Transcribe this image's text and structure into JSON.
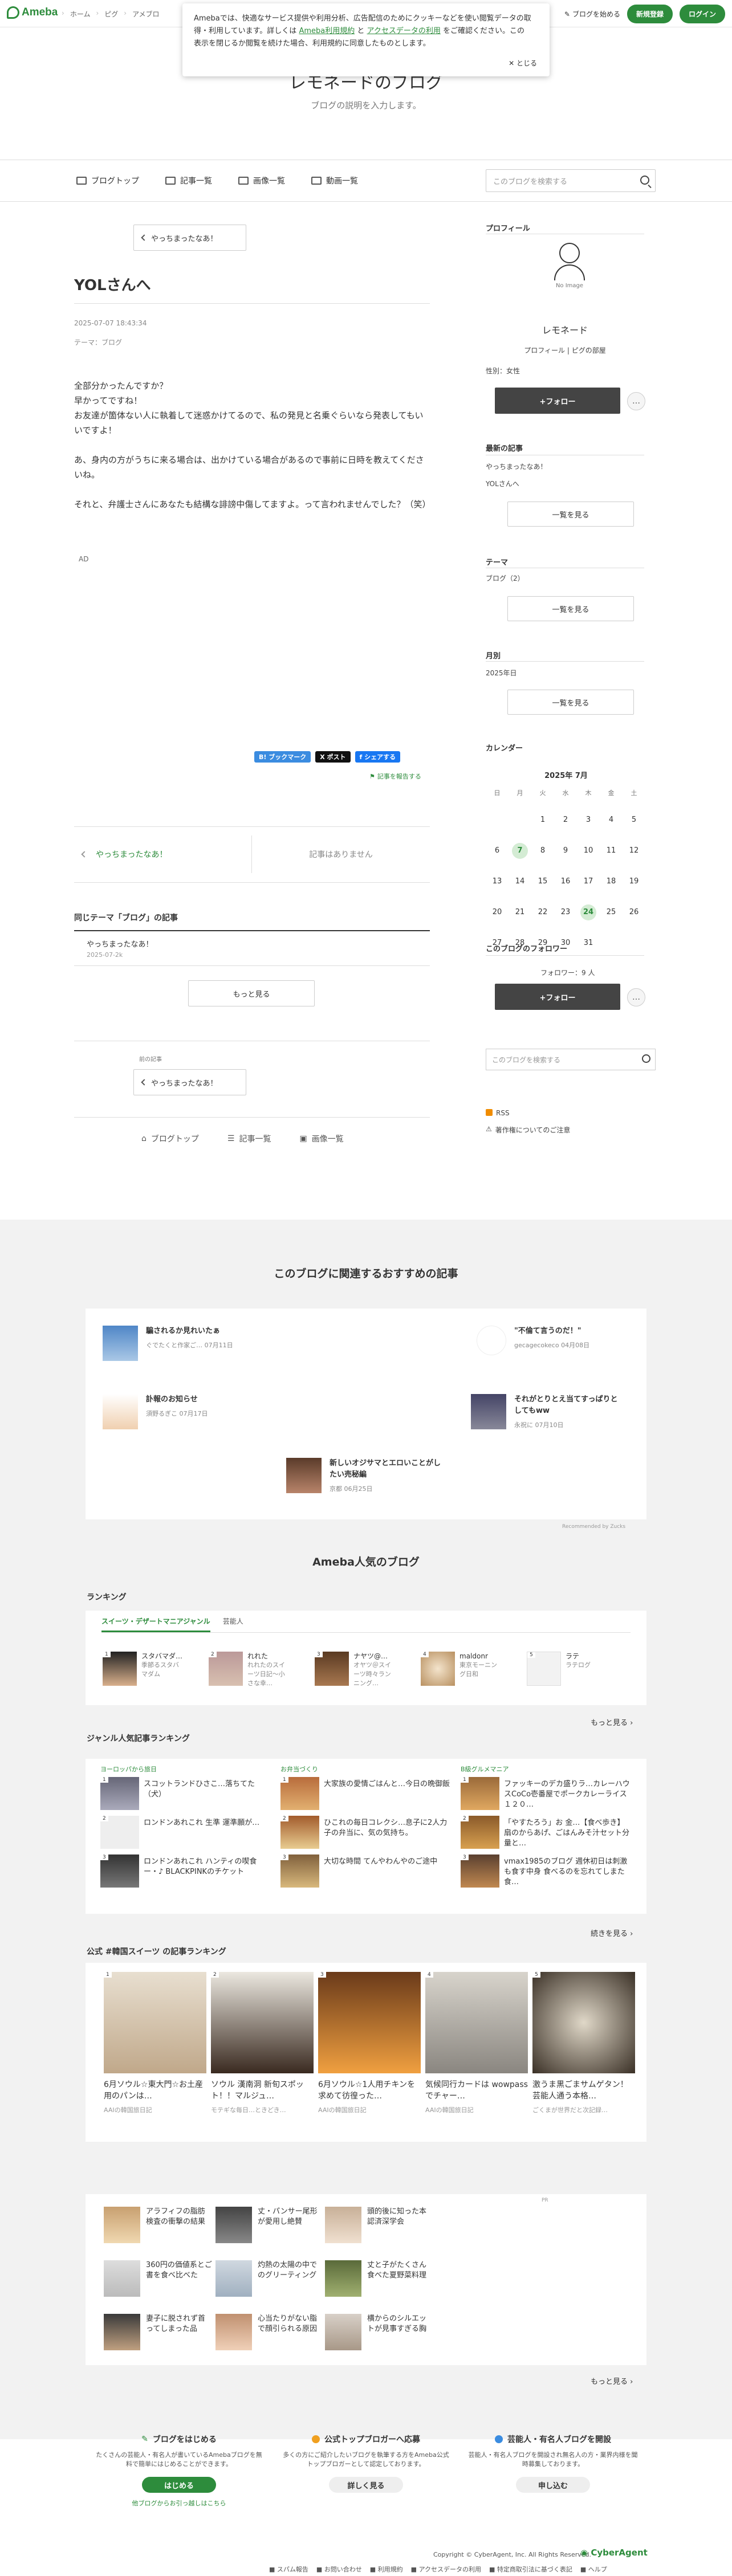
{
  "topbar": {
    "logo": "Ameba",
    "breadcrumb": [
      "ホーム",
      "ピグ",
      "アメブロ"
    ],
    "new_blog": "ブログを始める",
    "register": "新規登録",
    "login": "ログイン"
  },
  "cookie": {
    "line1": "Amebaでは、快適なサービス提供や利用分析、広告配信のためにクッキーなどを使い閲覧データの取",
    "line2a": "得・利用しています。詳しくは",
    "link1": "Ameba利用規約",
    "and": "と",
    "link2": "アクセスデータの利用",
    "line2b": "をご確認ください。この",
    "line3": "表示を閉じるか閲覧を続けた場合、利用規約に同意したものとします。",
    "close": "とじる"
  },
  "header": {
    "title": "レモネードのブログ",
    "description": "ブログの説明を入力します。"
  },
  "nav": {
    "items": [
      "ブログトップ",
      "記事一覧",
      "画像一覧",
      "動画一覧"
    ],
    "search_placeholder": "このブログを検索する"
  },
  "article": {
    "prev_button": "やっちまったなあ！",
    "title": "YOLさんへ",
    "date": "2025-07-07 18:43:34",
    "theme": "テーマ：ブログ",
    "paragraphs": [
      "全部分かったんですか？\n早かってですね！\nお友達が箇体ない人に執着して迷惑かけてるので、私の発見と名乗ぐらいなら発表してもいいですよ！",
      "あ、身内の方がうちに来る場合は、出かけている場合があるので事前に日時を教えてくださいね。",
      "それと、弁護士さんにあなたも結構な誹謗中傷してますよ。って言われませんでした？（笑）"
    ],
    "ad": "AD",
    "share": {
      "bookmark": "B! ブックマーク",
      "x": "X ポスト",
      "facebook": "f シェアする"
    },
    "report": "記事を報告する",
    "pager_prev": "やっちまったなあ！",
    "pager_next": "記事はありません"
  },
  "same_theme": {
    "heading": "同じテーマ「ブログ」の記事",
    "items": [
      {
        "title": "やっちまったなあ！",
        "date": "2025-07-2k"
      }
    ],
    "more": "もっと見る"
  },
  "prev_section": {
    "label": "前の記事",
    "button": "やっちまったなあ！"
  },
  "bottom_nav": [
    "ブログトップ",
    "記事一覧",
    "画像一覧"
  ],
  "sidebar": {
    "profile_heading": "プロフィール",
    "no_image": "No Image",
    "name": "レモネード",
    "profile_link": "プロフィール",
    "room_link": "ピグの部屋",
    "gender": "性別：女性",
    "follow": "+フォロー",
    "follow_more": "…",
    "recent_heading": "最新の記事",
    "recent_items": [
      "やっちまったなあ！",
      "YOLさんへ"
    ],
    "list_button": "一覧を見る",
    "theme_heading": "テーマ",
    "theme_item": "ブログ（2）",
    "month_heading": "月別",
    "month_item": "2025年日",
    "calendar_heading": "カレンダー",
    "calendar_month": "2025年 7月",
    "weekdays": [
      "日",
      "月",
      "火",
      "水",
      "木",
      "金",
      "土"
    ],
    "days": [
      "",
      "",
      "1",
      "2",
      "3",
      "4",
      "5",
      "6",
      "7",
      "8",
      "9",
      "10",
      "11",
      "12",
      "13",
      "14",
      "15",
      "16",
      "17",
      "18",
      "19",
      "20",
      "21",
      "22",
      "23",
      "24",
      "25",
      "26",
      "27",
      "28",
      "29",
      "30",
      "31",
      "",
      ""
    ],
    "highlight_days": [
      "7",
      "24"
    ],
    "followers_heading": "このブログのフォロワー",
    "followers_count": "フォロワー：9 人",
    "search_placeholder": "このブログを検索する",
    "rss": "RSS",
    "copyright_report": "著作権についてのご注意"
  },
  "recommend": {
    "title": "このブログに関連するおすすめの記事",
    "items": [
      {
        "title": "騙されるか見れいたぁ",
        "meta": "ぐでたくと作家ご… 07月11日"
      },
      {
        "title": "\"不倫て言うのだ！\"",
        "meta": "gecagecokeco 04月08日"
      },
      {
        "title": "訃報のお知らせ",
        "meta": "須野るぎこ 07月17日"
      },
      {
        "title": "それがとりとえ当てすっぱりとしてもww",
        "meta": "永祝に 07月10日"
      },
      {
        "title": "新しいオジサマとエロいことがしたい売秘編",
        "meta": "京都 06月25日"
      }
    ],
    "credit": "Recommended by Zucks"
  },
  "popular": {
    "title": "Ameba人気のブログ",
    "ranking_heading": "ランキング",
    "tabs": [
      "スイーツ・デザートマニアジャンル",
      "芸能人"
    ],
    "ranking": [
      {
        "no": "1",
        "t": "スタバマダ…",
        "s": "季節るスタバマダム"
      },
      {
        "no": "2",
        "t": "れれた",
        "s": "れれたのスイーツ日記〜小さな幸…"
      },
      {
        "no": "3",
        "t": "ナヤツ@…",
        "s": "オヤツ＠スイーツ時々ランニング…"
      },
      {
        "no": "4",
        "t": "maldonr",
        "s": "東京モーニング日和"
      },
      {
        "no": "5",
        "t": "ラテ",
        "s": "ラテログ"
      }
    ],
    "more": "もっと見る",
    "genre_heading": "ジャンル人気記事ランキング",
    "genres": [
      {
        "cat": "ヨーロッパから旅日",
        "items": [
          "スコットランドひさこ…落ちてた（犬）",
          "ロンドンあれこれ 生準 運準願が…",
          "ロンドンあれこれ ハンティの喫食ー・♪ BLACKPINKのチケット"
        ]
      },
      {
        "cat": "お弁当づくり",
        "items": [
          "大家族の愛情ごはんと…今日の晩御飯",
          "ひこれの毎日コレクシ…息子に2人力子の弁当に、気の気持ち。",
          "大切な時間 てんやわんやのご途中"
        ]
      },
      {
        "cat": "B級グルメマニア",
        "items": [
          "ファッキーのデカ盛りラ…カレーハウスCoCo壱番屋でポークカレーライス１２０…",
          "「やすたろう」お 金…【食べ歩き】扇のからあげ、ごはんみそ汁セット分量と…",
          "vmax1985のブログ 週休初日は刺激も食す中身 食べるのを忘れてしまた 食…"
        ]
      }
    ],
    "genre_more": "続きを見る",
    "kr_heading": "公式 #韓国スイーツ の記事ランキング",
    "kr": [
      {
        "no": "1",
        "t": "6月ソウル☆東大門☆お土産用のパンは…",
        "s": "AAIの韓国旅日記"
      },
      {
        "no": "2",
        "t": "ソウル 漢南洞 新旬スポット！！マルジュ…",
        "s": "モテギな毎日…ときどき…"
      },
      {
        "no": "3",
        "t": "6月ソウル☆1人用チキンを求めて彷徨った…",
        "s": "AAIの韓国旅日記"
      },
      {
        "no": "4",
        "t": "気候同行カードは wowpassでチャー…",
        "s": "AAIの韓国旅日記"
      },
      {
        "no": "5",
        "t": "激うま黒ごまサムゲタン！芸能人通う本格…",
        "s": "ごくまが世界だと次記録…"
      }
    ],
    "kr_more": "続きを見る"
  },
  "pr": {
    "tag": "PR",
    "items": [
      "アラフィフの脂肪検査の衝撃の結果",
      "丈・パンサー尾形が愛用し絶賛",
      "頭的後に知った本認済深学会",
      "360円の価値系とご書を食べ比べた",
      "灼熱の太陽の中でのグリーティング",
      "丈と子がたくさん食べた夏野菜料理",
      "妻子に脱されず首ってしまった品",
      "心当たりがない脂で顔引られる原因",
      "横からのシルエットが見事すぎる胸"
    ],
    "more": "もっと見る"
  },
  "cta": [
    {
      "title": "ブログをはじめる",
      "desc": "たくさんの芸能人・有名人が書いているAmebaブログを無料で簡単にはじめることができます。",
      "btn": "はじめる",
      "link": "他ブログからお引っ越しはこちら"
    },
    {
      "title": "公式トップブロガーへ応募",
      "desc": "多くの方にご紹介したいブログを執筆する方をAmeba公式トップブロガーとして認定しております。",
      "btn": "詳しく見る",
      "link": ""
    },
    {
      "title": "芸能人・有名人ブログを開設",
      "desc": "芸能人・有名人ブログを開設され無名人の方・業界内様を聞時募集しております。",
      "btn": "申し込む",
      "link": ""
    }
  ],
  "footer": {
    "copyright": "Copyright © CyberAgent, Inc. All Rights Reserved.",
    "company": "CyberAgent",
    "links": [
      "スパム報告",
      "お問い合わせ",
      "利用規約",
      "アクセスデータの利用",
      "特定商取引法に基づく表記",
      "ヘルプ"
    ]
  },
  "colors": {
    "brand_green": "#2d8c3c",
    "follow_button": "#444444"
  }
}
